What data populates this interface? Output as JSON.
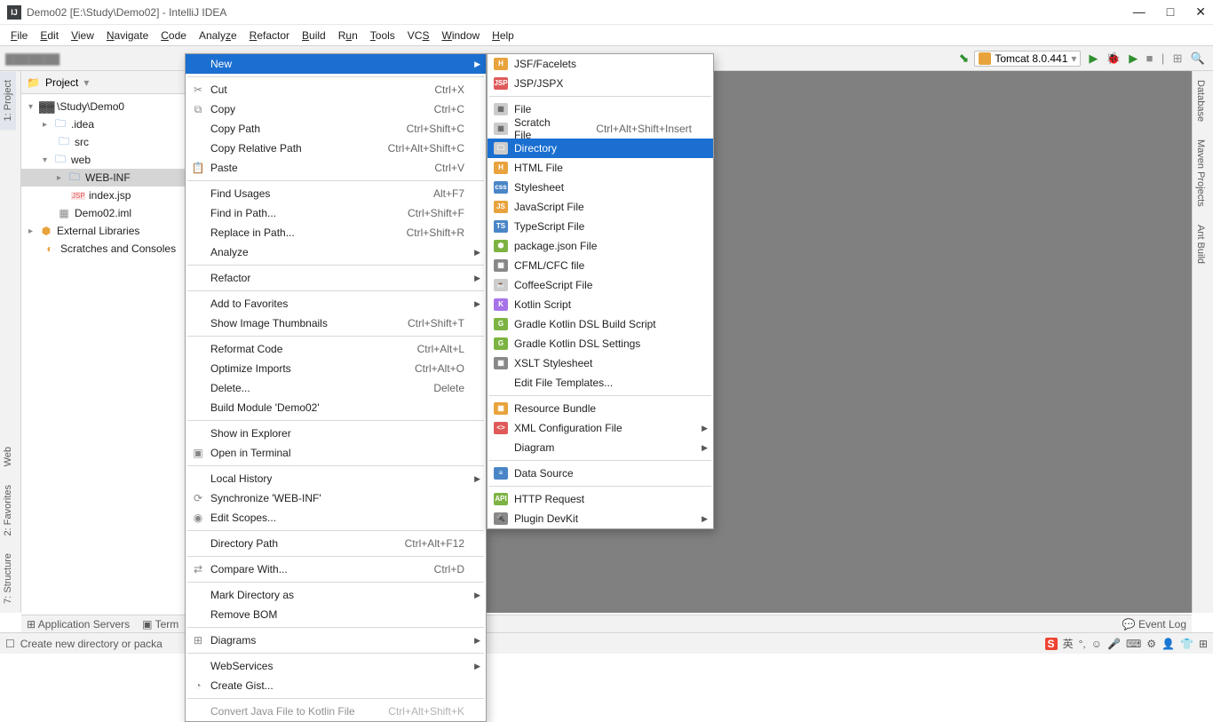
{
  "title": "Demo02 [E:\\Study\\Demo02] - IntelliJ IDEA",
  "menus": [
    "File",
    "Edit",
    "View",
    "Navigate",
    "Code",
    "Analyze",
    "Refactor",
    "Build",
    "Run",
    "Tools",
    "VCS",
    "Window",
    "Help"
  ],
  "run_config": "Tomcat 8.0.441",
  "project_label": "Project",
  "tree": {
    "root_path": "\\Study\\Demo0",
    "idea": ".idea",
    "src": "src",
    "web": "web",
    "webinf": "WEB-INF",
    "index": "index.jsp",
    "iml": "Demo02.iml",
    "ext": "External Libraries",
    "scratch": "Scratches and Consoles"
  },
  "left_tabs": {
    "project": "1: Project",
    "web": "Web",
    "favorites": "2: Favorites",
    "structure": "7: Structure"
  },
  "right_tabs": {
    "database": "Database",
    "maven": "Maven Projects",
    "ant": "Ant Build"
  },
  "ctx": {
    "new": "New",
    "cut": "Cut",
    "cut_k": "Ctrl+X",
    "copy": "Copy",
    "copy_k": "Ctrl+C",
    "copypath": "Copy Path",
    "copypath_k": "Ctrl+Shift+C",
    "copyrel": "Copy Relative Path",
    "copyrel_k": "Ctrl+Alt+Shift+C",
    "paste": "Paste",
    "paste_k": "Ctrl+V",
    "findusages": "Find Usages",
    "findusages_k": "Alt+F7",
    "findinpath": "Find in Path...",
    "findinpath_k": "Ctrl+Shift+F",
    "replaceinpath": "Replace in Path...",
    "replaceinpath_k": "Ctrl+Shift+R",
    "analyze": "Analyze",
    "refactor": "Refactor",
    "favorites": "Add to Favorites",
    "thumbnails": "Show Image Thumbnails",
    "thumbnails_k": "Ctrl+Shift+T",
    "reformat": "Reformat Code",
    "reformat_k": "Ctrl+Alt+L",
    "optimize": "Optimize Imports",
    "optimize_k": "Ctrl+Alt+O",
    "delete": "Delete...",
    "delete_k": "Delete",
    "buildmod": "Build Module 'Demo02'",
    "explorer": "Show in Explorer",
    "terminal": "Open in Terminal",
    "localhist": "Local History",
    "sync": "Synchronize 'WEB-INF'",
    "editscopes": "Edit Scopes...",
    "dirpath": "Directory Path",
    "dirpath_k": "Ctrl+Alt+F12",
    "compare": "Compare With...",
    "compare_k": "Ctrl+D",
    "markdir": "Mark Directory as",
    "removebom": "Remove BOM",
    "diagrams": "Diagrams",
    "webservices": "WebServices",
    "creategist": "Create Gist...",
    "convertkt": "Convert Java File to Kotlin File",
    "convertkt_k": "Ctrl+Alt+Shift+K"
  },
  "sub": {
    "jsf": "JSF/Facelets",
    "jspx": "JSP/JSPX",
    "file": "File",
    "scratch": "Scratch File",
    "scratch_k": "Ctrl+Alt+Shift+Insert",
    "directory": "Directory",
    "html": "HTML File",
    "stylesheet": "Stylesheet",
    "jsfile": "JavaScript File",
    "tsfile": "TypeScript File",
    "pkgjson": "package.json File",
    "cfml": "CFML/CFC file",
    "coffee": "CoffeeScript File",
    "kotlin": "Kotlin Script",
    "gradle_build": "Gradle Kotlin DSL Build Script",
    "gradle_settings": "Gradle Kotlin DSL Settings",
    "xslt": "XSLT Stylesheet",
    "templates": "Edit File Templates...",
    "resourcebundle": "Resource Bundle",
    "xmlconfig": "XML Configuration File",
    "diagram": "Diagram",
    "datasource": "Data Source",
    "httpreq": "HTTP Request",
    "plugindev": "Plugin DevKit"
  },
  "status_top": {
    "appservers": "Application Servers",
    "term": "Term",
    "eventlog": "Event Log"
  },
  "status": {
    "msg": "Create new directory or packa",
    "lang": "英"
  }
}
